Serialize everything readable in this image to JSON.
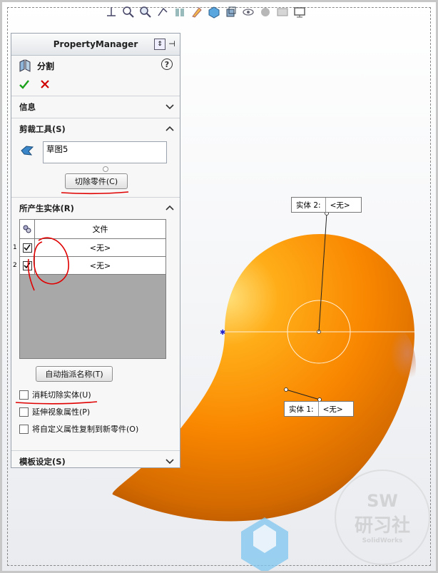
{
  "pm": {
    "header": "PropertyManager",
    "feature_name": "分割",
    "help": "?",
    "sections": {
      "info": "信息",
      "trim_tools": "剪裁工具(S)",
      "bodies": "所产生实体(R)",
      "template": "模板设定(S)"
    },
    "trim_input": "草图5",
    "cut_button": "切除零件(C)",
    "table": {
      "file_header": "文件",
      "rows": [
        {
          "num": "1",
          "value": "<无>"
        },
        {
          "num": "2",
          "value": "<无>"
        }
      ]
    },
    "auto_assign_button": "自动指派名称(T)",
    "options": {
      "consume": "消耗切除实体(U)",
      "propagate": "延伸视象属性(P)",
      "copy_props": "将自定义属性复制到新零件(O)"
    }
  },
  "callouts": {
    "body2_label": "实体  2:",
    "body2_value": "<无>",
    "body1_label": "实体  1:",
    "body1_value": "<无>"
  },
  "watermark": {
    "sw": "SW",
    "cn": "研习社",
    "small": "SolidWorks"
  },
  "colors": {
    "shape_orange": "#ff8a00",
    "annotation_red": "#e00000",
    "ok_green": "#1aa01a",
    "cancel_red": "#d00000"
  },
  "icons": [
    "front-view-icon",
    "zoom-fit-icon",
    "zoom-area-icon",
    "previous-view-icon",
    "section-view-icon",
    "dynamic-annotation-icon",
    "view-orientation-icon",
    "display-style-icon",
    "hide-show-icon",
    "edit-appearance-icon",
    "apply-scene-icon",
    "view-settings-icon"
  ]
}
